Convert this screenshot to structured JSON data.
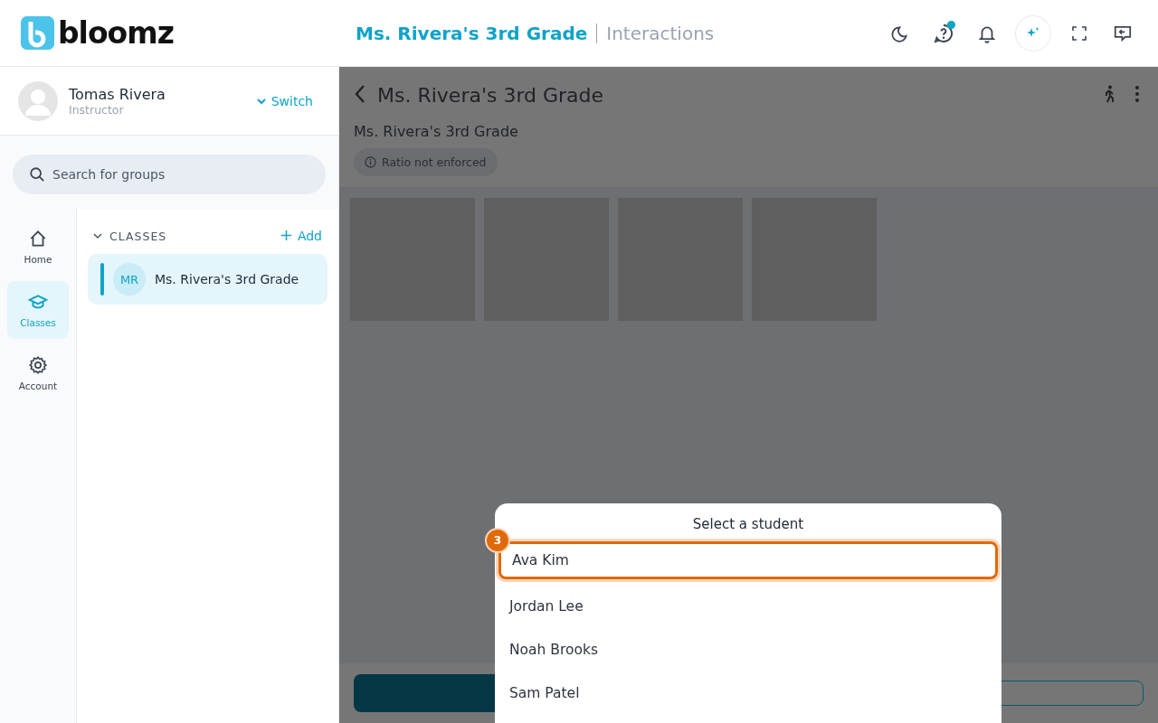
{
  "header": {
    "logo": "bloomz",
    "group_title": "Ms. Rivera's 3rd Grade",
    "section": "Interactions",
    "help_has_dot": true
  },
  "profile": {
    "name": "Tomas Rivera",
    "role": "Instructor",
    "switch_label": "Switch"
  },
  "search": {
    "placeholder": "Search for groups"
  },
  "nav": [
    {
      "label": "Home",
      "kind": "home",
      "selected": false
    },
    {
      "label": "Classes",
      "kind": "classes",
      "selected": true
    },
    {
      "label": "Account",
      "kind": "account",
      "selected": false
    }
  ],
  "classes": {
    "heading": "CLASSES",
    "add_label": "Add",
    "items": [
      {
        "initials": "MR",
        "name": "Ms. Rivera's 3rd Grade",
        "selected": true
      }
    ]
  },
  "main": {
    "title": "Ms. Rivera's 3rd Grade",
    "subtitle": "Ms. Rivera's 3rd Grade",
    "chip": "Ratio not enforced",
    "tiles": [
      {
        "kind": "placeholder"
      },
      {
        "kind": "placeholder"
      },
      {
        "kind": "placeholder"
      },
      {
        "kind": "placeholder"
      }
    ]
  },
  "picker": {
    "title": "Select a student",
    "step_badge": "3",
    "students": [
      {
        "name": "Ava Kim",
        "selected": true
      },
      {
        "name": "Jordan Lee",
        "selected": false
      },
      {
        "name": "Noah Brooks",
        "selected": false
      },
      {
        "name": "Sam Patel",
        "selected": false
      }
    ]
  }
}
